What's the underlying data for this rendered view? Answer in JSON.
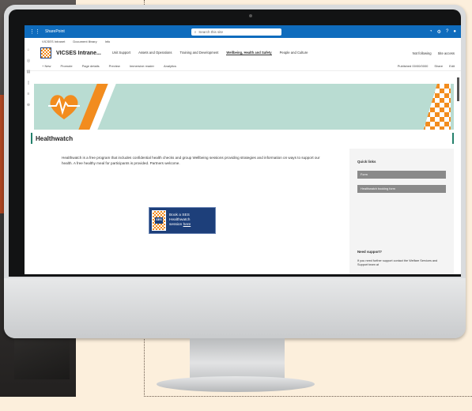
{
  "suitebar": {
    "app": "SharePoint",
    "search_placeholder": "Search this site"
  },
  "hubnav": {
    "items": [
      "VICSES Intranet",
      "Document library",
      "Info"
    ]
  },
  "site": {
    "name": "VICSES Intrane...",
    "nav": [
      "Unit Support",
      "Assets and Operations",
      "Training and Development",
      "Wellbeing, Health and Safety",
      "People and Culture"
    ],
    "active_nav": "Wellbeing, Health and Safety",
    "follow": "Not following",
    "share": "Site access"
  },
  "cmdbar": {
    "items": [
      "+ New",
      "Promote",
      "Page details",
      "Preview",
      "Immersive reader",
      "Analytics"
    ],
    "published": "Published 00/00/0000",
    "share": "Share",
    "edit": "Edit"
  },
  "page": {
    "title": "Healthwatch",
    "body": "Healthwatch is a free program that includes confidential health checks and group Wellbeing sessions providing strategies and information on ways to support our health. A free healthy meal for participants is provided. Partners welcome.",
    "cta_logo": "SES",
    "cta_line1": "Book a SES",
    "cta_line2": "Healthwatch",
    "cta_line3_prefix": "session",
    "cta_link": "here"
  },
  "quick_links": {
    "title": "Quick links",
    "items": [
      "Form",
      "Healthwatch booking form"
    ]
  },
  "support": {
    "title": "Need support?",
    "text": "If you need further support contact the Welfare Services and Support team at"
  },
  "colors": {
    "brand_blue": "#1d3f7a",
    "brand_orange": "#f28c1e",
    "banner_teal": "#b9dcd2",
    "suitebar": "#0f6cbd"
  }
}
